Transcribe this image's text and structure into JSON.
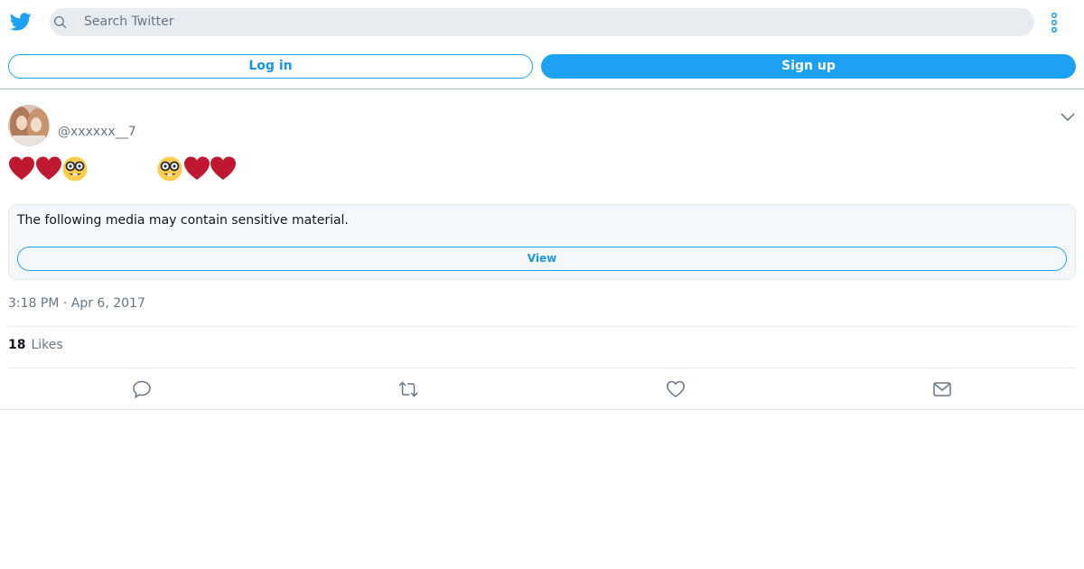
{
  "header": {
    "logo_icon": "twitter-bird-icon",
    "search_placeholder": "Search Twitter",
    "more_icon": "more-vertical-icon"
  },
  "auth": {
    "login_label": "Log in",
    "signup_label": "Sign up"
  },
  "tweet": {
    "handle": "@xxxxxx__7",
    "emojis_left": [
      "red-heart",
      "red-heart",
      "nerd-face"
    ],
    "emojis_right": [
      "nerd-face",
      "red-heart",
      "red-heart"
    ],
    "sensitive_message": "The following media may contain sensitive material.",
    "view_label": "View",
    "timestamp": "3:18 PM · Apr 6, 2017",
    "likes_count": "18",
    "likes_label": "Likes"
  },
  "actions": [
    "reply-icon",
    "retweet-icon",
    "like-icon",
    "share-icon"
  ],
  "colors": {
    "brand": "#1da1f2",
    "link": "#1b95e0",
    "muted": "#657786",
    "heart": "#be1931"
  }
}
